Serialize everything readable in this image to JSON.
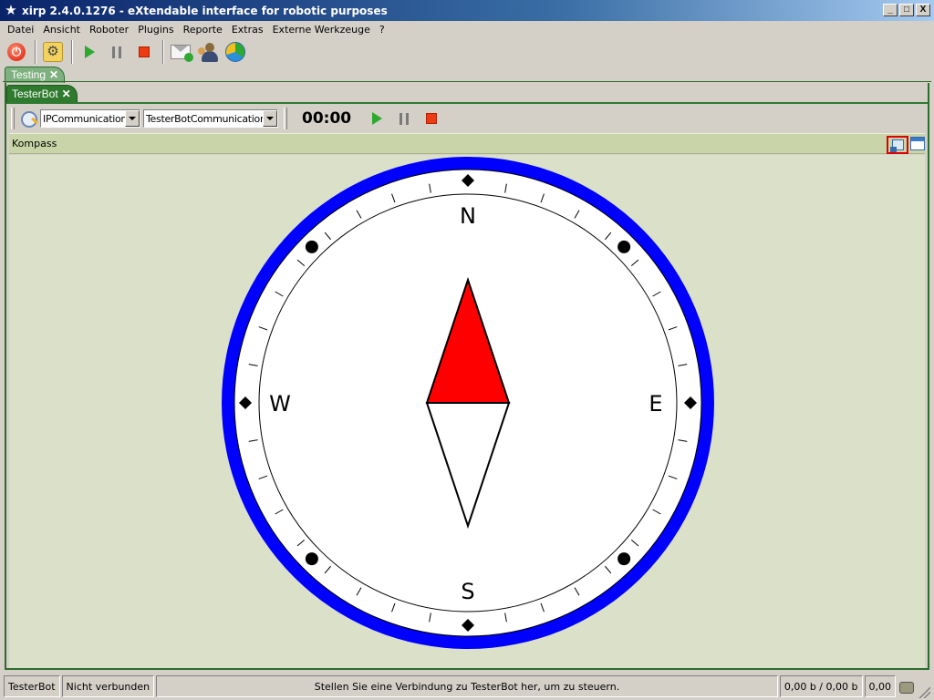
{
  "window": {
    "title": "xirp 2.4.0.1276 - eXtendable interface for robotic purposes",
    "icon": "star-icon",
    "minimize": "_",
    "maximize": "□",
    "close": "X"
  },
  "menu": [
    "Datei",
    "Ansicht",
    "Roboter",
    "Plugins",
    "Reporte",
    "Extras",
    "Externe Werkzeuge",
    "?"
  ],
  "toolbar": {
    "icons": [
      "power-icon",
      "settings-gear-icon",
      "play-icon",
      "pause-icon",
      "stop-icon",
      "mail-icon",
      "contacts-icon",
      "chart-icon"
    ]
  },
  "tabs": {
    "outer": "Testing",
    "inner": "TesterBot"
  },
  "robot_toolbar": {
    "communication": "IPCommunication",
    "protocol": "TesterBotCommunication",
    "timer": "00:00"
  },
  "panel": {
    "title": "Kompass"
  },
  "compass": {
    "labels": {
      "north": "N",
      "east": "E",
      "south": "S",
      "west": "W"
    },
    "heading_degrees": 0,
    "colors": {
      "ring": "#0000ff",
      "face": "#ffffff",
      "needle_north": "#ff0000",
      "needle_south": "#ffffff"
    }
  },
  "status": {
    "robot": "TesterBot",
    "connection": "Nicht verbunden",
    "message": "Stellen Sie eine Verbindung zu TesterBot her, um zu steuern.",
    "traffic": "0,00 b / 0,00 b",
    "rate": "0,00"
  }
}
